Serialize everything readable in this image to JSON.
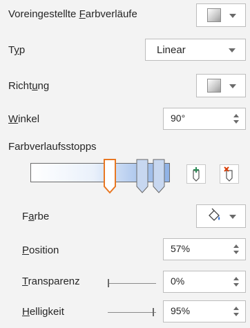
{
  "preset_gradients": {
    "label_pre": "Voreingestellte ",
    "label_key": "F",
    "label_post": "arbverläufe"
  },
  "type": {
    "label_pre": "T",
    "label_key": "y",
    "label_post": "p",
    "value": "Linear"
  },
  "direction": {
    "label_pre": "Richt",
    "label_key": "u",
    "label_post": "ng"
  },
  "angle": {
    "label_key": "W",
    "label_post": "inkel",
    "value": "90°"
  },
  "gradient_stops": {
    "label": "Farbverlaufsstopps",
    "stops_percent": [
      57,
      80,
      92
    ],
    "selected_index": 0,
    "add_stop_icon": "add-gradient-stop-icon",
    "remove_stop_icon": "remove-gradient-stop-icon"
  },
  "color": {
    "label_pre": "F",
    "label_key": "a",
    "label_post": "rbe",
    "icon": "paint-bucket-icon"
  },
  "position": {
    "label_key": "P",
    "label_post": "osition",
    "value": "57%"
  },
  "transparency": {
    "label_key": "T",
    "label_post": "ransparenz",
    "value": "0%",
    "slider_percent": 0
  },
  "brightness": {
    "label_key": "H",
    "label_post": "elligkeit",
    "value": "95%",
    "slider_percent": 95
  },
  "colors": {
    "selected_stop": "#e87722",
    "gradient_start": "#ffffff",
    "gradient_end": "#a9c4ec",
    "accent_red": "#d83b01",
    "accent_green": "#2e8b57"
  }
}
